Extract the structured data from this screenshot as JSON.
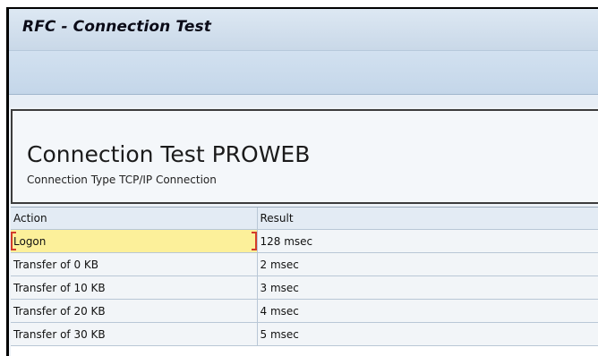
{
  "window": {
    "title": "RFC - Connection Test"
  },
  "header": {
    "heading": "Connection Test PROWEB",
    "subheading": "Connection Type TCP/IP Connection"
  },
  "table": {
    "columns": [
      "Action",
      "Result"
    ],
    "rows": [
      {
        "action": "Logon",
        "result": "128 msec"
      },
      {
        "action": "Transfer of 0 KB",
        "result": "2 msec"
      },
      {
        "action": "Transfer of 10 KB",
        "result": "3 msec"
      },
      {
        "action": "Transfer of 20 KB",
        "result": "4 msec"
      },
      {
        "action": "Transfer of 30 KB",
        "result": "5 msec"
      }
    ],
    "selected_row": 0
  },
  "colors": {
    "selection": "#fcf09a",
    "selection_border": "#d33c2a",
    "titlebar": "#c9d8e8"
  }
}
